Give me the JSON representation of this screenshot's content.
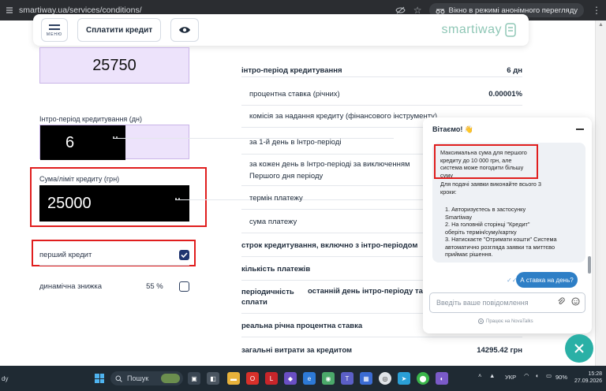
{
  "browser": {
    "url": "smartiway.ua/services/conditions/",
    "incognito_label": "Вікно в режимі анонімного перегляду"
  },
  "header": {
    "menu_label": "МЕНЮ",
    "pay_button": "Сплатити кредит",
    "logo_text": "smartiway"
  },
  "form": {
    "amount_value": "25750",
    "intro_label": "Інтро-період кредитування (дн)",
    "intro_value": "6",
    "sum_label": "Сума/ліміт кредиту (грн)",
    "sum_value": "25000",
    "first_credit_label": "перший кредит",
    "first_credit_checked": true,
    "discount_label": "динамічна знижка",
    "discount_value": "55 %",
    "discount_checked": false
  },
  "table": {
    "rows": [
      {
        "label": "інтро-період кредитування",
        "value": "6 дн",
        "bold": true,
        "sub": false
      },
      {
        "label": "процентна ставка (річних)",
        "value": "0.00001%",
        "bold": false,
        "sub": true
      },
      {
        "label": "комісія за надання кредиту (фінансового інструменту)",
        "value": "",
        "bold": false,
        "sub": true
      },
      {
        "label": "за 1-й день в Інтро-періоді",
        "value": "",
        "bold": false,
        "sub": true
      },
      {
        "label": "за кожен день в Інтро-періоді за виключенням Першого дня періоду",
        "value": "",
        "bold": false,
        "sub": true
      },
      {
        "label": "термін платежу",
        "value": "",
        "bold": false,
        "sub": true
      },
      {
        "label": "сума платежу",
        "value": "",
        "bold": false,
        "sub": true
      },
      {
        "label": "строк кредитування, включно з інтро-періодом",
        "value": "",
        "bold": true,
        "sub": false
      },
      {
        "label": "кількість платежів",
        "value": "",
        "bold": true,
        "sub": false
      },
      {
        "label": "періодичність сплати",
        "value": "",
        "bold": true,
        "sub": false
      },
      {
        "label": "реальна річна процентна ставка",
        "value": "",
        "bold": true,
        "sub": false
      },
      {
        "label": "загальні витрати за кредитом",
        "value": "14295.42 грн",
        "bold": true,
        "sub": false
      }
    ],
    "periodicity_extra": "останній день інтро-періоду та і"
  },
  "chat": {
    "greeting": "Вітаємо! 👋",
    "msg_highlight": "Максимальна сума для першого кредиту до 10 000 грн, але система може погодити більшу суму",
    "msg_steps_intro": "Для подачі заявки виконайте всього 3 кроки:",
    "step_1": "1. Авторизуєтесь в застосунку Smartiway",
    "step_2": "2. На головній сторінці \"Кредит\" оберіть термін/суму/картку",
    "step_3": "3. Натискаєте \"Отримати кошти\" Система автоматично розгляда заявки та миттєво приймає рішення.",
    "user_question": "А ставка на день?",
    "input_placeholder": "Введіть ваше повідомлення",
    "powered_by": "Працює на NovaTalks"
  },
  "taskbar": {
    "left_text": "dy",
    "search_label": "Пошук",
    "lang": "УКР",
    "battery": "90%",
    "time": "15:28",
    "date": "27.09.2026"
  },
  "colors": {
    "accent_red": "#e01e1e",
    "navy": "#1f3570",
    "lilac": "#ede3fb",
    "teal": "#2ab0a6",
    "chat_blue": "#2e7fc6"
  }
}
